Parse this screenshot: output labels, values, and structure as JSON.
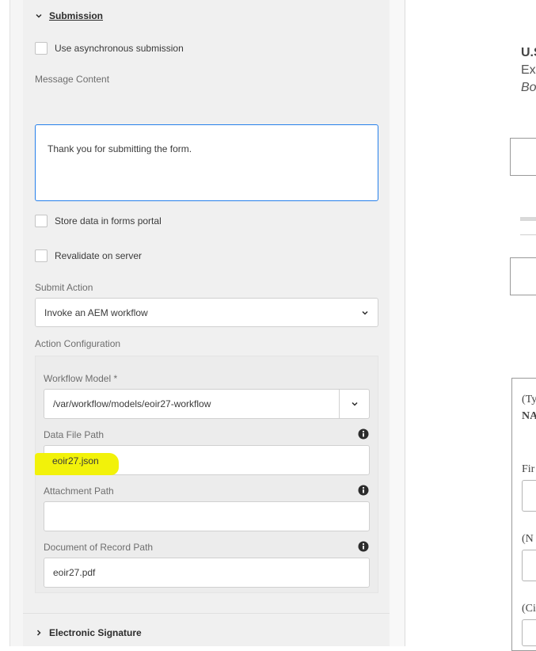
{
  "submission_section": {
    "title": "Submission",
    "async_label": "Use asynchronous submission",
    "message_content_label": "Message Content",
    "message_content_value": "Thank you for submitting the form.",
    "store_data_label": "Store data in forms portal",
    "revalidate_label": "Revalidate on server",
    "submit_action_label": "Submit Action",
    "submit_action_value": "Invoke an AEM workflow",
    "action_config_label": "Action Configuration",
    "workflow_model_label": "Workflow Model *",
    "workflow_model_value": "/var/workflow/models/eoir27-workflow",
    "data_file_path_label": "Data File Path",
    "data_file_path_value": "eoir27.json",
    "attachment_path_label": "Attachment Path",
    "attachment_path_value": "",
    "dor_path_label": "Document of Record Path",
    "dor_path_value": "eoir27.pdf"
  },
  "esign_section": {
    "title": "Electronic Signature"
  },
  "preview": {
    "line1": "U.S",
    "line2": "Ex",
    "line3": "Bo",
    "serif1": "(Ty",
    "serif2": "NA",
    "serif3": "Fir",
    "serif4": "(N",
    "serif5": "(Ci"
  },
  "colors": {
    "focus_border": "#2680eb",
    "highlight": "#f2f20a",
    "panel_bg": "#f0f0f0"
  },
  "icons": [
    "chevron-down-icon",
    "chevron-right-icon",
    "info-icon"
  ]
}
